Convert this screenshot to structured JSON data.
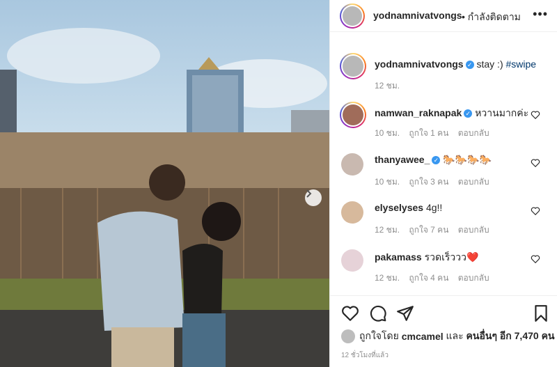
{
  "post": {
    "author": "yodnamnivatvongs",
    "follow_status": "• กำลังติดตาม",
    "caption_text": "stay :)",
    "caption_tag": "#swipe",
    "caption_time": "12 ชม."
  },
  "comments": [
    {
      "user": "namwan_raknapak",
      "verified": true,
      "text": "หวานมากค่ะ",
      "time": "10 ชม.",
      "likes": "ถูกใจ 1 คน",
      "reply": "ตอบกลับ"
    },
    {
      "user": "thanyawee_",
      "verified": true,
      "text": "🐎🐎🐎🐎",
      "time": "10 ชม.",
      "likes": "ถูกใจ 3 คน",
      "reply": "ตอบกลับ"
    },
    {
      "user": "elyselyses",
      "verified": false,
      "text": "4g!!",
      "time": "12 ชม.",
      "likes": "ถูกใจ 7 คน",
      "reply": "ตอบกลับ"
    },
    {
      "user": "pakamass",
      "verified": false,
      "text": "รวดเร็ววว❤️",
      "time": "12 ชม.",
      "likes": "ถูกใจ 4 คน",
      "reply": "ตอบกลับ"
    }
  ],
  "likes_line": {
    "prefix": "ถูกใจโดย",
    "user": "cmcamel",
    "mid": "และ",
    "others": "คนอื่นๆ อีก 7,470 คน"
  },
  "timestamp": "12 ชั่วโมงที่แล้ว",
  "icons": {
    "like": "heart-icon",
    "comment": "comment-icon",
    "share": "share-icon",
    "save": "bookmark-icon",
    "more": "more-options-icon",
    "next": "chevron-right-icon"
  },
  "colors": {
    "verified": "#3897f0",
    "link": "#00376b",
    "meta": "#8e8e8e"
  }
}
